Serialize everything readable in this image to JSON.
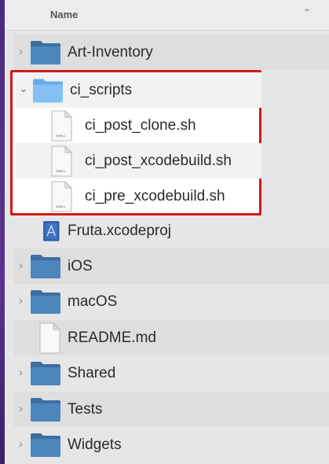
{
  "header": {
    "column_name": "Name",
    "sort_icon": "chevron-up-icon"
  },
  "colors": {
    "highlight_border": "#d11a1a",
    "folder": "#4d86bd",
    "folder_selected": "#84c0f5"
  },
  "rows": [
    {
      "label": "Art-Inventory",
      "type": "folder"
    },
    {
      "label": "Fruta.xcodeproj",
      "type": "xcodeproj"
    },
    {
      "label": "iOS",
      "type": "folder"
    },
    {
      "label": "macOS",
      "type": "folder"
    },
    {
      "label": "README.md",
      "type": "file"
    },
    {
      "label": "Shared",
      "type": "folder"
    },
    {
      "label": "Tests",
      "type": "folder"
    },
    {
      "label": "Widgets",
      "type": "folder"
    }
  ],
  "highlighted": {
    "folder": {
      "label": "ci_scripts",
      "expanded": true
    },
    "children": [
      {
        "label": "ci_post_clone.sh",
        "badge": "SHELL"
      },
      {
        "label": "ci_post_xcodebuild.sh",
        "badge": "SHELL"
      },
      {
        "label": "ci_pre_xcodebuild.sh",
        "badge": "SHELL"
      }
    ]
  }
}
